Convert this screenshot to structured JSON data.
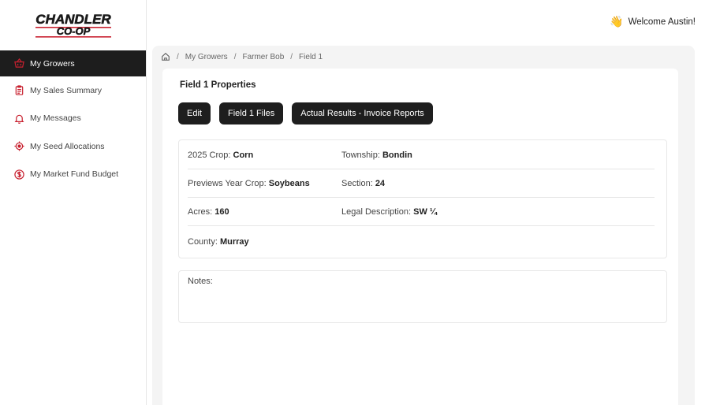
{
  "brand": {
    "name": "CHANDLER",
    "sub": "CO-OP",
    "accent": "#c8202f"
  },
  "header": {
    "welcome": "Welcome Austin!",
    "wave_emoji": "👋"
  },
  "sidebar": {
    "items": [
      {
        "label": "My Growers",
        "icon": "basket-icon",
        "active": true
      },
      {
        "label": "My Sales Summary",
        "icon": "clipboard-icon",
        "active": false
      },
      {
        "label": "My Messages",
        "icon": "bell-icon",
        "active": false
      },
      {
        "label": "My Seed Allocations",
        "icon": "target-icon",
        "active": false
      },
      {
        "label": "My Market Fund Budget",
        "icon": "dollar-icon",
        "active": false
      }
    ]
  },
  "breadcrumb": {
    "items": [
      "My Growers",
      "Farmer Bob",
      "Field 1"
    ],
    "separator": "/"
  },
  "card": {
    "title": "Field 1 Properties",
    "buttons": {
      "edit": "Edit",
      "files": "Field 1 Files",
      "results": "Actual Results - Invoice Reports"
    }
  },
  "properties": {
    "crop": {
      "label": "2025 Crop:",
      "value": "Corn"
    },
    "township": {
      "label": "Township:",
      "value": "Bondin"
    },
    "prev_crop": {
      "label": "Previews Year Crop:",
      "value": "Soybeans"
    },
    "section": {
      "label": "Section:",
      "value": "24"
    },
    "acres": {
      "label": "Acres:",
      "value": "160"
    },
    "legal": {
      "label": "Legal Description:",
      "value": "SW ¼"
    },
    "county": {
      "label": "County:",
      "value": "Murray"
    }
  },
  "notes": {
    "label": "Notes:"
  }
}
